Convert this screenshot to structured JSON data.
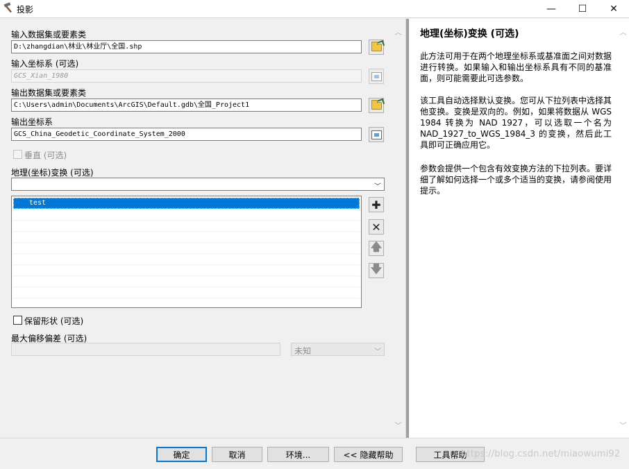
{
  "window": {
    "title": "投影",
    "app_icon": "hammer-icon",
    "controls": {
      "minimize": "—",
      "maximize": "☐",
      "close": "✕"
    }
  },
  "form": {
    "input_dataset_label": "输入数据集或要素类",
    "input_dataset_value": "D:\\zhangdian\\林业\\林业厅\\全国.shp",
    "input_cs_label": "输入坐标系 (可选)",
    "input_cs_value": "GCS_Xian_1980",
    "output_dataset_label": "输出数据集或要素类",
    "output_dataset_value": "C:\\Users\\admin\\Documents\\ArcGIS\\Default.gdb\\全国_Project1",
    "output_cs_label": "输出坐标系",
    "output_cs_value": "GCS_China_Geodetic_Coordinate_System_2000",
    "vertical_label": "垂直 (可选)",
    "geo_transform_label": "地理(坐标)变换 (可选)",
    "geo_transform_dropdown_value": "",
    "transform_list": [
      "test"
    ],
    "preserve_shape_label": "保留形状 (可选)",
    "max_offset_label": "最大偏移偏差 (可选)",
    "max_offset_unit": "未知"
  },
  "help": {
    "title": "地理(坐标)变换 (可选)",
    "paragraphs": [
      "此方法可用于在两个地理坐标系或基准面之间对数据进行转换。如果输入和输出坐标系具有不同的基准面，则可能需要此可选参数。",
      "该工具自动选择默认变换。您可从下拉列表中选择其他变换。变换是双向的。例如，如果将数据从 WGS 1984 转换为 NAD 1927，可以选取一个名为 NAD_1927_to_WGS_1984_3 的变换，然后此工具即可正确应用它。",
      "参数会提供一个包含有效变换方法的下拉列表。要详细了解如何选择一个或多个适当的变换，请参阅使用提示。"
    ]
  },
  "buttons": {
    "ok": "确定",
    "cancel": "取消",
    "environments": "环境...",
    "hide_help": "<< 隐藏帮助",
    "tool_help": "工具帮助"
  },
  "watermark": "https://blog.csdn.net/miaowumi92"
}
